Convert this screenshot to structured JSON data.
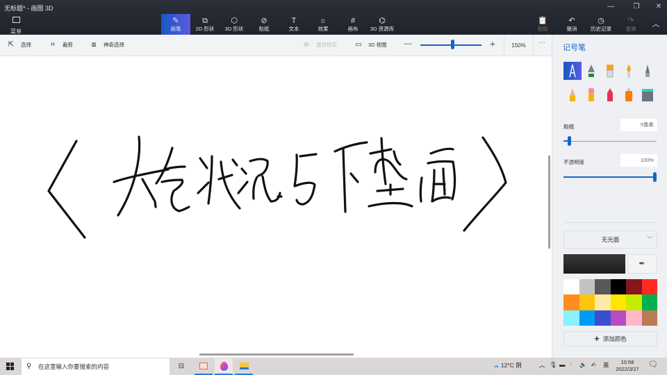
{
  "window": {
    "title": "无标题* - 画图 3D",
    "controls": {
      "minimize": "—",
      "maximize": "❐",
      "close": "✕"
    }
  },
  "ribbon": {
    "menu": {
      "label": "菜单",
      "icon": "folder-icon"
    },
    "tools": [
      {
        "label": "画笔",
        "icon": "brush-icon",
        "active": true
      },
      {
        "label": "2D 形状",
        "icon": "2d-shapes-icon"
      },
      {
        "label": "3D 形状",
        "icon": "3d-shapes-icon"
      },
      {
        "label": "贴纸",
        "icon": "stickers-icon"
      },
      {
        "label": "文本",
        "icon": "text-icon"
      },
      {
        "label": "效果",
        "icon": "effects-icon"
      },
      {
        "label": "画布",
        "icon": "canvas-icon"
      },
      {
        "label": "3D 资源库",
        "icon": "3d-library-icon"
      }
    ],
    "actions": [
      {
        "label": "粘贴",
        "icon": "paste-icon",
        "disabled": true
      },
      {
        "label": "撤消",
        "icon": "undo-icon"
      },
      {
        "label": "历史记录",
        "icon": "history-icon"
      },
      {
        "label": "重做",
        "icon": "redo-icon",
        "disabled": true
      }
    ],
    "collapse_icon": "chevron-up-icon"
  },
  "toolbar": {
    "select": "选择",
    "crop": "裁剪",
    "magic_select": "神奇选择",
    "mixed_reality": "混合现实",
    "view_3d": "3D 视图",
    "zoom_minus": "—",
    "zoom_plus": "+",
    "zoom_level": "150%",
    "zoom_percent": 52,
    "more": "···"
  },
  "canvas": {
    "handwriting": "《大气状况与下垫面》",
    "ink_color": "#111111"
  },
  "panel": {
    "title": "记号笔",
    "brushes": [
      {
        "name": "marker",
        "active": true
      },
      {
        "name": "calligraphy-pen"
      },
      {
        "name": "oil-brush"
      },
      {
        "name": "watercolor"
      },
      {
        "name": "pixel-pen"
      },
      {
        "name": "pencil"
      },
      {
        "name": "eraser"
      },
      {
        "name": "crayon"
      },
      {
        "name": "spray-can"
      },
      {
        "name": "fill-bucket"
      }
    ],
    "thickness": {
      "label": "粗细",
      "value": "5像素",
      "percent": 5
    },
    "opacity": {
      "label": "不透明度",
      "value": "100%",
      "percent": 100
    },
    "finish": {
      "selected": "无光面"
    },
    "current_color": "#1b1b1b",
    "palette": [
      "#ffffff",
      "#c3c3c3",
      "#585858",
      "#000000",
      "#88141c",
      "#ff2a22",
      "#ff8c1f",
      "#ffc40c",
      "#ffe9a3",
      "#ffe600",
      "#c6eb00",
      "#00b050",
      "#88f2ff",
      "#009bf4",
      "#3a4fce",
      "#b84cc3",
      "#ffb7cb",
      "#b97a56"
    ],
    "add_color": "添加颜色"
  },
  "taskbar": {
    "search_placeholder": "在这里输入你要搜索的内容",
    "weather": "12°C 阴",
    "ime": "英",
    "time": "10:58",
    "date": "2022/3/27"
  }
}
